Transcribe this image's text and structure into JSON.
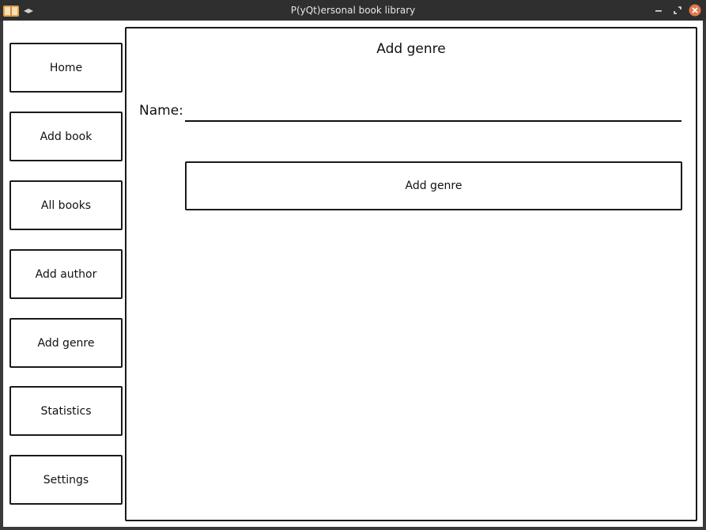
{
  "window": {
    "title": "P(yQt)ersonal book library",
    "accent_close": "#e07a4a"
  },
  "sidebar": {
    "items": [
      {
        "label": "Home"
      },
      {
        "label": "Add book"
      },
      {
        "label": "All books"
      },
      {
        "label": "Add author"
      },
      {
        "label": "Add genre"
      },
      {
        "label": "Statistics"
      },
      {
        "label": "Settings"
      }
    ]
  },
  "main": {
    "title": "Add genre",
    "name_label": "Name:",
    "name_value": "",
    "submit_label": "Add genre"
  },
  "icons": {
    "app": "book-icon",
    "nav": "arrows-left-right-icon",
    "minimize": "minimize-icon",
    "maximize": "maximize-icon",
    "close": "close-icon"
  }
}
